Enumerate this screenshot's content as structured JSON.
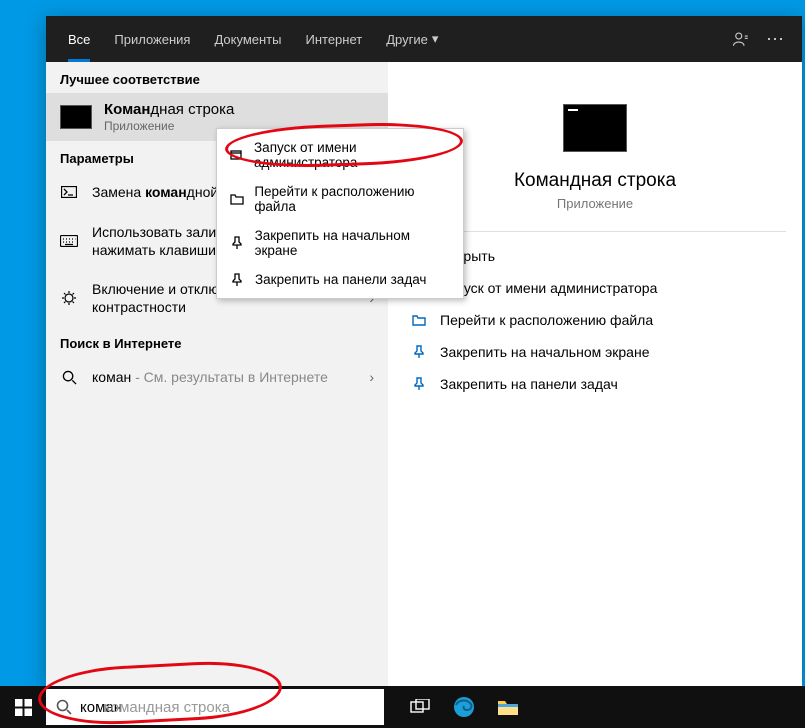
{
  "tabs": {
    "all": "Все",
    "apps": "Приложения",
    "docs": "Документы",
    "web": "Интернет",
    "more": "Другие"
  },
  "sections": {
    "best": "Лучшее соответствие",
    "params": "Параметры",
    "websearch": "Поиск в Интернете"
  },
  "best_match": {
    "title_match": "Коман",
    "title_rest": "дная строка",
    "subtitle": "Приложение"
  },
  "params": [
    {
      "icon": "shell",
      "pre": "Замена ",
      "match": "коман",
      "post": "дной оболочку Windows"
    },
    {
      "icon": "keyboard",
      "pre": "Использовать залипание клавиш, чтобы нажимать клавиши по",
      "match": "",
      "post": ""
    },
    {
      "icon": "contrast",
      "pre": "Включение и отключение высокой контрастности",
      "match": "",
      "post": ""
    }
  ],
  "web": {
    "query": "коман",
    "hint": " - См. результаты в Интернете"
  },
  "preview": {
    "title": "Командная строка",
    "subtitle": "Приложение",
    "actions": {
      "open": "Открыть",
      "admin": "Запуск от имени администратора",
      "location": "Перейти к расположению файла",
      "pin_start": "Закрепить на начальном экране",
      "pin_tb": "Закрепить на панели задач"
    }
  },
  "context_menu": {
    "admin": "Запуск от имени администратора",
    "location": "Перейти к расположению файла",
    "pin_start": "Закрепить на начальном экране",
    "pin_tb": "Закрепить на панели задач"
  },
  "search": {
    "typed": "коман",
    "ghost_full": "командная строка"
  }
}
